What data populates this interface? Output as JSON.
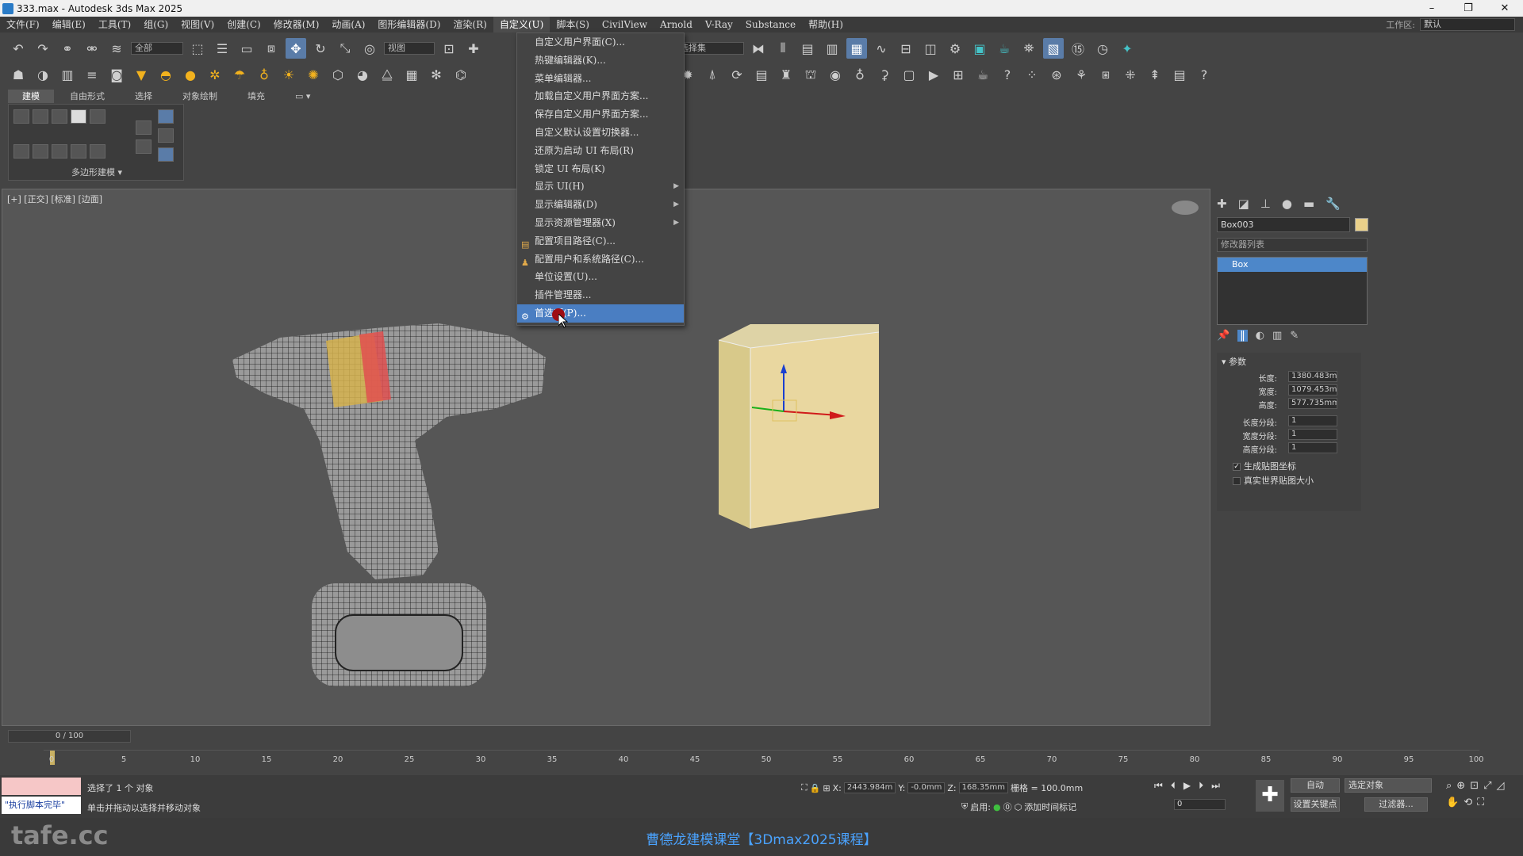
{
  "window": {
    "title": "333.max - Autodesk 3ds Max 2025",
    "controls": [
      "–",
      "❐",
      "✕"
    ]
  },
  "menubar": {
    "items": [
      "文件(F)",
      "编辑(E)",
      "工具(T)",
      "组(G)",
      "视图(V)",
      "创建(C)",
      "修改器(M)",
      "动画(A)",
      "图形编辑器(D)",
      "渲染(R)",
      "自定义(U)",
      "脚本(S)",
      "CivilView",
      "Arnold",
      "V-Ray",
      "Substance",
      "帮助(H)"
    ],
    "active_index": 10,
    "workspace_label": "工作区:",
    "workspace_value": "默认"
  },
  "toolbar": {
    "filter_select": "全部",
    "ref_coord_select": "视图",
    "named_sel_select": "创建选择集"
  },
  "ribbon": {
    "tabs": [
      "建模",
      "自由形式",
      "选择",
      "对象绘制",
      "填充"
    ],
    "active_tab": 0,
    "panel_label": "多边形建模 ▾"
  },
  "viewport": {
    "label": "[+] [正交] [标准] [边面]"
  },
  "dropdown": {
    "items": [
      {
        "label": "自定义用户界面(C)...",
        "submenu": false
      },
      {
        "label": "热键编辑器(K)...",
        "submenu": false
      },
      {
        "label": "菜单编辑器...",
        "submenu": false
      },
      {
        "label": "加载自定义用户界面方案...",
        "submenu": false
      },
      {
        "label": "保存自定义用户界面方案...",
        "submenu": false
      },
      {
        "label": "自定义默认设置切换器...",
        "submenu": false
      },
      {
        "label": "还原为启动 UI 布局(R)",
        "submenu": false
      },
      {
        "label": "锁定 UI 布局(K)",
        "submenu": false
      },
      {
        "label": "显示 UI(H)",
        "submenu": true
      },
      {
        "label": "显示编辑器(D)",
        "submenu": true
      },
      {
        "label": "显示资源管理器(X)",
        "submenu": true
      },
      {
        "label": "配置项目路径(C)...",
        "submenu": false
      },
      {
        "label": "配置用户和系统路径(C)...",
        "submenu": false
      },
      {
        "label": "单位设置(U)...",
        "submenu": false
      },
      {
        "label": "插件管理器...",
        "submenu": false
      },
      {
        "label": "首选项(P)...",
        "submenu": false
      }
    ],
    "highlighted_index": 15
  },
  "command_panel": {
    "object_name": "Box003",
    "object_color": "#e9d08a",
    "modifier_list": "修改器列表",
    "stack_item": "Box",
    "rollout_title": "参数",
    "params": [
      {
        "label": "长度:",
        "value": "1380.483m"
      },
      {
        "label": "宽度:",
        "value": "1079.453m"
      },
      {
        "label": "高度:",
        "value": "577.735mm"
      },
      {
        "label": "长度分段:",
        "value": "1"
      },
      {
        "label": "宽度分段:",
        "value": "1"
      },
      {
        "label": "高度分段:",
        "value": "1"
      }
    ],
    "checkboxes": [
      {
        "label": "生成贴图坐标",
        "checked": true
      },
      {
        "label": "真实世界贴图大小",
        "checked": false
      }
    ]
  },
  "timeline": {
    "slider_text": "0 / 100",
    "ticks": [
      0,
      5,
      10,
      15,
      20,
      25,
      30,
      35,
      40,
      45,
      50,
      55,
      60,
      65,
      70,
      75,
      80,
      85,
      90,
      95,
      100
    ]
  },
  "status": {
    "listener_text": "\"执行脚本完毕\"",
    "selection_text": "选择了 1 个 对象",
    "prompt_text": "单击并拖动以选择并移动对象",
    "x_label": "X:",
    "x_value": "2443.984m",
    "y_label": "Y:",
    "y_value": "-0.0mm",
    "z_label": "Z:",
    "z_value": "168.35mm",
    "grid_text": "栅格 = 100.0mm",
    "enabled_label": "启用:",
    "add_tag": "添加时间标记",
    "auto_key": "自动",
    "selected_obj": "选定对象",
    "set_key": "设置关键点",
    "filter": "过滤器...",
    "frame_value": "0"
  },
  "footer": {
    "watermark": "tafe.cc",
    "caption": "曹德龙建模课堂【3Dmax2025课程】"
  }
}
